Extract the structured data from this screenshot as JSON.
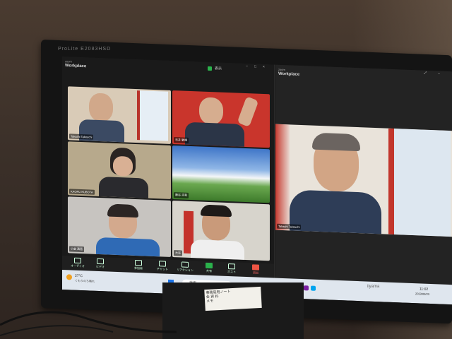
{
  "monitor": {
    "brand": "ProLite E2083HSD",
    "brand_bottom": "iiyama"
  },
  "left_window": {
    "app_small": "zoom",
    "app_title": "Workplace",
    "view_label": "表示",
    "participants": [
      {
        "name": "Takashi Takeuchi",
        "bg": "#d9cbb7"
      },
      {
        "name": "石井 敏隆",
        "bg": "#c9352c"
      },
      {
        "name": "KAORU KUBOTA",
        "bg": "#b7a98c"
      },
      {
        "name": "藤谷 宗和",
        "bg": "#4c7fc6"
      },
      {
        "name": "小倉 真吾",
        "bg": "#c7c4c0"
      },
      {
        "name": "大谷",
        "bg": "#d7d4cc"
      }
    ],
    "toolbar": [
      {
        "label": "オーディオ",
        "icon": "microphone-icon"
      },
      {
        "label": "ビデオ",
        "icon": "video-camera-icon"
      },
      {
        "label": "参加者",
        "icon": "participants-icon"
      },
      {
        "label": "チャット",
        "icon": "chat-icon"
      },
      {
        "label": "リアクション",
        "icon": "heart-icon"
      },
      {
        "label": "共有",
        "icon": "share-screen-icon"
      },
      {
        "label": "ホスト",
        "icon": "more-icon"
      },
      {
        "label": "退出",
        "icon": "leave-icon"
      }
    ]
  },
  "right_window": {
    "app_small": "zoom",
    "app_title": "Workplace",
    "speaker_name": "Takashi Takeuchi"
  },
  "taskbar": {
    "weather": "27°C",
    "weather_sub": "くもりのち晴れ",
    "search_placeholder": "検索",
    "time": "11:02",
    "date": "2023/09/23"
  },
  "note": {
    "lines": [
      "事務局用ノート",
      "会 資 料",
      "メモ"
    ]
  }
}
